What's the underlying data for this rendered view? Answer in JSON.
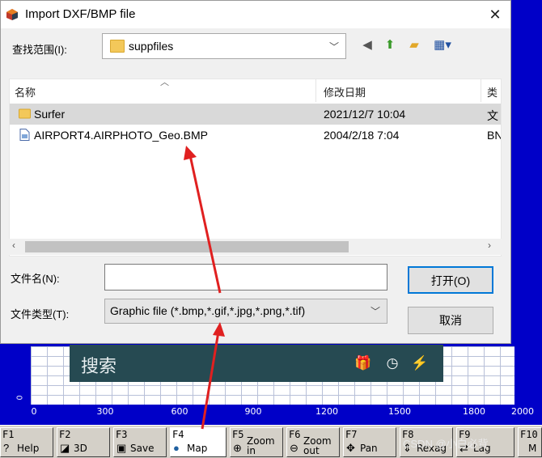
{
  "dialog": {
    "title": "Import DXF/BMP file",
    "close_glyph": "✕",
    "lookin_label": "查找范围(I):",
    "lookin_value": "suppfiles",
    "columns": [
      "名称",
      "修改日期",
      "类"
    ],
    "files": [
      {
        "name": "Surfer",
        "date": "2021/12/7 10:04",
        "type": "文",
        "icon": "folder-icon",
        "selected": true
      },
      {
        "name": "AIRPORT4.AIRPHOTO_Geo.BMP",
        "date": "2004/2/18 7:04",
        "type": "BN",
        "icon": "file-icon",
        "selected": false
      }
    ],
    "filename_label": "文件名(N):",
    "filename_value": "",
    "filetype_label": "文件类型(T):",
    "filetype_value": "Graphic file (*.bmp,*.gif,*.jpg,*.png,*.tif)",
    "open_label": "打开(O)",
    "cancel_label": "取消"
  },
  "toolbar_icons": [
    "back-icon",
    "up-folder-icon",
    "new-folder-icon",
    "view-menu-icon"
  ],
  "search_bar": {
    "label": "搜索"
  },
  "graph": {
    "x_ticks": [
      "0",
      "300",
      "600",
      "900",
      "1200",
      "1500",
      "1800",
      "2000"
    ],
    "y_tick": "0"
  },
  "fkeys": [
    {
      "key": "F1",
      "label": "Help"
    },
    {
      "key": "F2",
      "label": "3D"
    },
    {
      "key": "F3",
      "label": "Save"
    },
    {
      "key": "F4",
      "label": "Map"
    },
    {
      "key": "F5",
      "label": "Zoom in"
    },
    {
      "key": "F6",
      "label": "Zoom out"
    },
    {
      "key": "F7",
      "label": "Pan"
    },
    {
      "key": "F8",
      "label": "Rexag"
    },
    {
      "key": "F9",
      "label": "Lag"
    },
    {
      "key": "F10",
      "label": "M"
    }
  ],
  "watermark": "CSDN @小白必背",
  "colors": {
    "accent": "#0078d7",
    "background": "#0000c8",
    "annotation_arrow": "#e02020",
    "search_bar": "#264a52"
  }
}
